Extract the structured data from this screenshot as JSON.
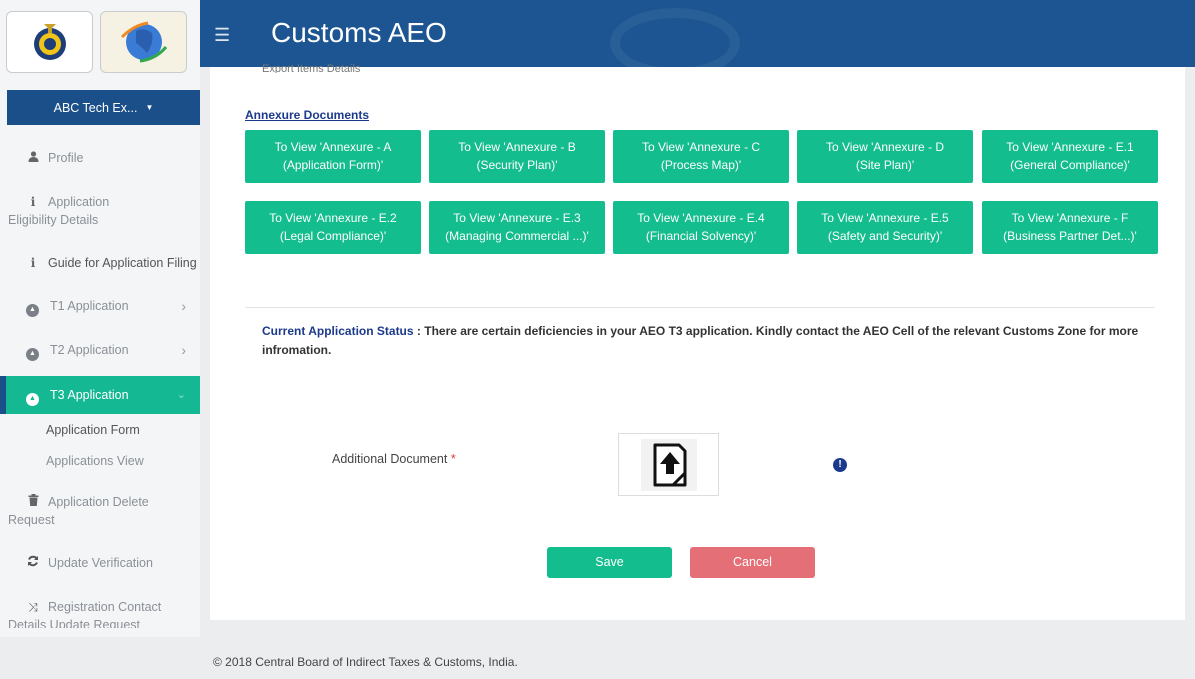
{
  "app": {
    "title": "Customs AEO",
    "menu_icon": "hamburger-icon"
  },
  "user": {
    "name": "ABC Tech Ex...",
    "caret": "▼"
  },
  "sidebar": {
    "items": [
      {
        "label": "Profile",
        "icon": "user-icon"
      },
      {
        "label_line1": "Application",
        "label_line2": "Eligibility Details",
        "icon": "info-icon"
      },
      {
        "label": "Guide for Application Filing",
        "icon": "info-icon"
      },
      {
        "label": "T1 Application",
        "icon": "circle-icon",
        "chevron": "›"
      },
      {
        "label": "T2 Application",
        "icon": "circle-icon",
        "chevron": "›"
      },
      {
        "label": "T3 Application",
        "icon": "circle-icon",
        "chevron": "⌄",
        "active": true
      },
      {
        "label_line1": "Application Delete",
        "label_line2": "Request",
        "icon": "trash-icon"
      },
      {
        "label": "Update Verification",
        "icon": "refresh-icon"
      },
      {
        "label_line1": "Registration Contact",
        "label_line2": "Details Update Request",
        "icon": "shuffle-icon"
      }
    ],
    "sub_items": [
      {
        "label": "Application Form"
      },
      {
        "label": "Applications View"
      }
    ]
  },
  "main": {
    "cut_text": "Export Items Details",
    "annexure_title": "Annexure Documents",
    "annexure_buttons": [
      {
        "line1": "To View 'Annexure - A",
        "line2": "(Application Form)'"
      },
      {
        "line1": "To View 'Annexure - B",
        "line2": "(Security Plan)'"
      },
      {
        "line1": "To View 'Annexure - C",
        "line2": "(Process Map)'"
      },
      {
        "line1": "To View 'Annexure - D",
        "line2": "(Site Plan)'"
      },
      {
        "line1": "To View 'Annexure - E.1",
        "line2": "(General Compliance)'"
      },
      {
        "line1": "To View 'Annexure - E.2",
        "line2": "(Legal Compliance)'"
      },
      {
        "line1": "To View 'Annexure - E.3",
        "line2": "(Managing Commercial ...)'"
      },
      {
        "line1": "To View 'Annexure - E.4",
        "line2": "(Financial Solvency)'"
      },
      {
        "line1": "To View 'Annexure - E.5",
        "line2": "(Safety and Security)'"
      },
      {
        "line1": "To View 'Annexure - F",
        "line2": "(Business Partner Det...)'"
      }
    ],
    "status_label": "Current Application Status",
    "status_sep": " : ",
    "status_text": "There are certain deficiencies in your AEO T3 application. Kindly contact the AEO Cell of the relevant Customs Zone for more infromation.",
    "additional_doc_label": "Additional Document",
    "required_mark": "*",
    "info_glyph": "!",
    "save_label": "Save",
    "cancel_label": "Cancel"
  },
  "footer": {
    "text": "© 2018 Central Board of Indirect Taxes & Customs, India."
  },
  "colors": {
    "primary": "#1c5591",
    "accent": "#14bd8d",
    "danger": "#e56f77",
    "link": "#1c3a8c"
  }
}
